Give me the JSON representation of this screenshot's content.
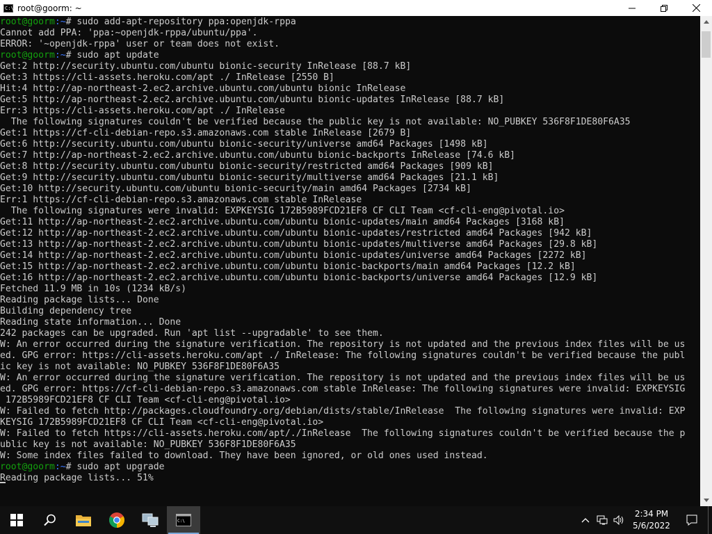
{
  "window": {
    "title": "root@goorm: ~",
    "icon_label": "C:\\"
  },
  "terminal": {
    "lines": [
      {
        "user": "root@goorm",
        "path": ":~",
        "text": "# sudo add-apt-repository ppa:openjdk-rppa"
      },
      {
        "text": "Cannot add PPA: 'ppa:~openjdk-rppa/ubuntu/ppa'."
      },
      {
        "text": "ERROR: '~openjdk-rppa' user or team does not exist."
      },
      {
        "user": "root@goorm",
        "path": ":~",
        "text": "# sudo apt update"
      },
      {
        "text": "Get:2 http://security.ubuntu.com/ubuntu bionic-security InRelease [88.7 kB]"
      },
      {
        "text": "Get:3 https://cli-assets.heroku.com/apt ./ InRelease [2550 B]"
      },
      {
        "text": "Hit:4 http://ap-northeast-2.ec2.archive.ubuntu.com/ubuntu bionic InRelease"
      },
      {
        "text": "Get:5 http://ap-northeast-2.ec2.archive.ubuntu.com/ubuntu bionic-updates InRelease [88.7 kB]"
      },
      {
        "text": "Err:3 https://cli-assets.heroku.com/apt ./ InRelease"
      },
      {
        "text": "  The following signatures couldn't be verified because the public key is not available: NO_PUBKEY 536F8F1DE80F6A35"
      },
      {
        "text": "Get:1 https://cf-cli-debian-repo.s3.amazonaws.com stable InRelease [2679 B]"
      },
      {
        "text": "Get:6 http://security.ubuntu.com/ubuntu bionic-security/universe amd64 Packages [1498 kB]"
      },
      {
        "text": "Get:7 http://ap-northeast-2.ec2.archive.ubuntu.com/ubuntu bionic-backports InRelease [74.6 kB]"
      },
      {
        "text": "Get:8 http://security.ubuntu.com/ubuntu bionic-security/restricted amd64 Packages [909 kB]"
      },
      {
        "text": "Get:9 http://security.ubuntu.com/ubuntu bionic-security/multiverse amd64 Packages [21.1 kB]"
      },
      {
        "text": "Get:10 http://security.ubuntu.com/ubuntu bionic-security/main amd64 Packages [2734 kB]"
      },
      {
        "text": "Err:1 https://cf-cli-debian-repo.s3.amazonaws.com stable InRelease"
      },
      {
        "text": "  The following signatures were invalid: EXPKEYSIG 172B5989FCD21EF8 CF CLI Team <cf-cli-eng@pivotal.io>"
      },
      {
        "text": "Get:11 http://ap-northeast-2.ec2.archive.ubuntu.com/ubuntu bionic-updates/main amd64 Packages [3168 kB]"
      },
      {
        "text": "Get:12 http://ap-northeast-2.ec2.archive.ubuntu.com/ubuntu bionic-updates/restricted amd64 Packages [942 kB]"
      },
      {
        "text": "Get:13 http://ap-northeast-2.ec2.archive.ubuntu.com/ubuntu bionic-updates/multiverse amd64 Packages [29.8 kB]"
      },
      {
        "text": "Get:14 http://ap-northeast-2.ec2.archive.ubuntu.com/ubuntu bionic-updates/universe amd64 Packages [2272 kB]"
      },
      {
        "text": "Get:15 http://ap-northeast-2.ec2.archive.ubuntu.com/ubuntu bionic-backports/main amd64 Packages [12.2 kB]"
      },
      {
        "text": "Get:16 http://ap-northeast-2.ec2.archive.ubuntu.com/ubuntu bionic-backports/universe amd64 Packages [12.9 kB]"
      },
      {
        "text": "Fetched 11.9 MB in 10s (1234 kB/s)"
      },
      {
        "text": "Reading package lists... Done"
      },
      {
        "text": "Building dependency tree"
      },
      {
        "text": "Reading state information... Done"
      },
      {
        "text": "242 packages can be upgraded. Run 'apt list --upgradable' to see them."
      },
      {
        "text": "W: An error occurred during the signature verification. The repository is not updated and the previous index files will be us"
      },
      {
        "text": "ed. GPG error: https://cli-assets.heroku.com/apt ./ InRelease: The following signatures couldn't be verified because the publ"
      },
      {
        "text": "ic key is not available: NO_PUBKEY 536F8F1DE80F6A35"
      },
      {
        "text": "W: An error occurred during the signature verification. The repository is not updated and the previous index files will be us"
      },
      {
        "text": "ed. GPG error: https://cf-cli-debian-repo.s3.amazonaws.com stable InRelease: The following signatures were invalid: EXPKEYSIG"
      },
      {
        "text": " 172B5989FCD21EF8 CF CLI Team <cf-cli-eng@pivotal.io>"
      },
      {
        "text": "W: Failed to fetch http://packages.cloudfoundry.org/debian/dists/stable/InRelease  The following signatures were invalid: EXP"
      },
      {
        "text": "KEYSIG 172B5989FCD21EF8 CF CLI Team <cf-cli-eng@pivotal.io>"
      },
      {
        "text": "W: Failed to fetch https://cli-assets.heroku.com/apt/./InRelease  The following signatures couldn't be verified because the p"
      },
      {
        "text": "ublic key is not available: NO_PUBKEY 536F8F1DE80F6A35"
      },
      {
        "text": "W: Some index files failed to download. They have been ignored, or old ones used instead."
      },
      {
        "user": "root@goorm",
        "path": ":~",
        "text": "# sudo apt upgrade"
      },
      {
        "text": "Reading package lists... 51%",
        "cursor": true
      }
    ],
    "colors": {
      "background": "#0c0c0c",
      "text": "#cccccc",
      "user": "#13a10e",
      "path": "#3b78ff"
    }
  },
  "taskbar": {
    "items": [
      {
        "name": "start-button",
        "icon": "windows-logo-icon"
      },
      {
        "name": "search-button",
        "icon": "search-icon"
      },
      {
        "name": "file-explorer-button",
        "icon": "folder-icon"
      },
      {
        "name": "chrome-button",
        "icon": "chrome-icon"
      },
      {
        "name": "network-app-button",
        "icon": "computer-icon"
      },
      {
        "name": "terminal-button",
        "icon": "terminal-icon",
        "active": true
      }
    ],
    "clock": {
      "time": "2:34 PM",
      "date": "5/6/2022"
    }
  }
}
